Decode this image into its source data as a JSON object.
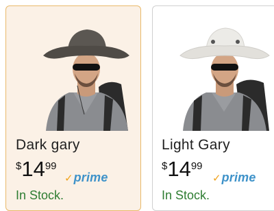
{
  "products": [
    {
      "name": "Dark gary",
      "price_symbol": "$",
      "price_whole": "14",
      "price_fraction": "99",
      "badge": "prime",
      "stock": "In Stock.",
      "hat_color": "#6a6560",
      "selected": true
    },
    {
      "name": "Light Gary",
      "price_symbol": "$",
      "price_whole": "14",
      "price_fraction": "99",
      "badge": "prime",
      "stock": "In Stock.",
      "hat_color": "#e9e7e2",
      "selected": false
    }
  ],
  "colors": {
    "selected_bg": "#fbf1e6",
    "selected_border": "#e9b96a",
    "prime_blue": "#3e92c9",
    "prime_check": "#f0a21b",
    "stock_green": "#2e7d32"
  }
}
